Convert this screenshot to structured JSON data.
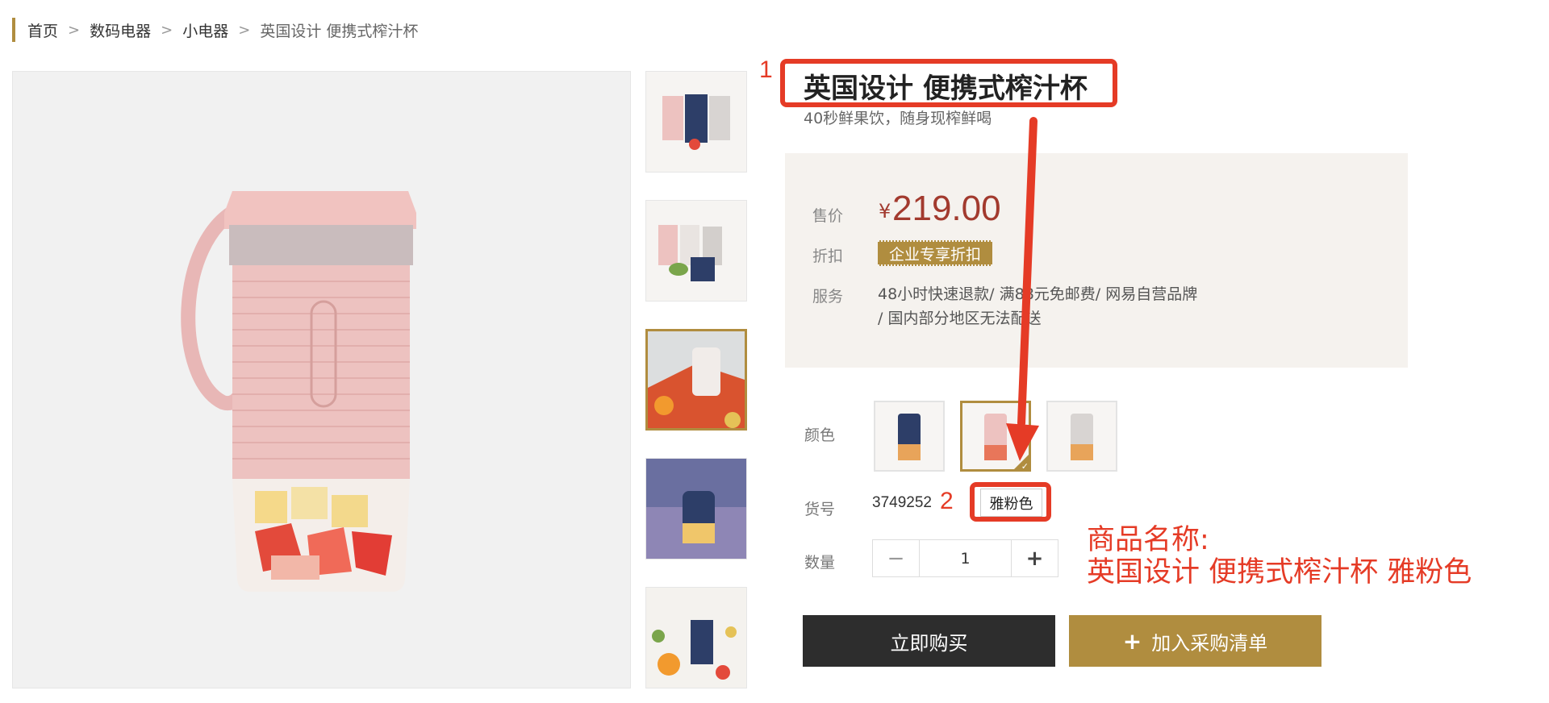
{
  "breadcrumb": {
    "items": [
      "首页",
      "数码电器",
      "小电器"
    ],
    "current": "英国设计 便携式榨汁杯"
  },
  "product": {
    "title": "英国设计 便携式榨汁杯",
    "subtitle": "40秒鲜果饮，随身现榨鲜喝",
    "price_label": "售价",
    "currency": "¥",
    "price": "219.00",
    "discount_label": "折扣",
    "discount_tag": "企业专享折扣",
    "service_label": "服务",
    "service_line1": "48小时快速退款/ 满88元免邮费/ 网易自营品牌",
    "service_line2": "/ 国内部分地区无法配送",
    "color_label": "颜色",
    "sku_label": "货号",
    "sku": "3749252",
    "selected_color": "雅粉色",
    "qty_label": "数量",
    "qty_value": "1",
    "qty_minus": "−",
    "qty_plus": "+",
    "buy_now": "立即购买",
    "add_to_list": "加入采购清单",
    "add_icon": "+"
  },
  "annotations": {
    "num1": "1",
    "num2": "2",
    "note_line1": "商品名称:",
    "note_line2": "英国设计 便携式榨汁杯 雅粉色"
  },
  "colors": {
    "accent_gold": "#b08d3f",
    "annotation_red": "#e53b26",
    "price_red": "#a23a2e",
    "dark_button": "#2d2d2d",
    "panel_bg": "#f5f2ee"
  },
  "icons": {
    "breadcrumb_separator": "chevron-right-icon",
    "selected_check": "check-icon",
    "annotation_arrow": "arrow-down-icon"
  }
}
